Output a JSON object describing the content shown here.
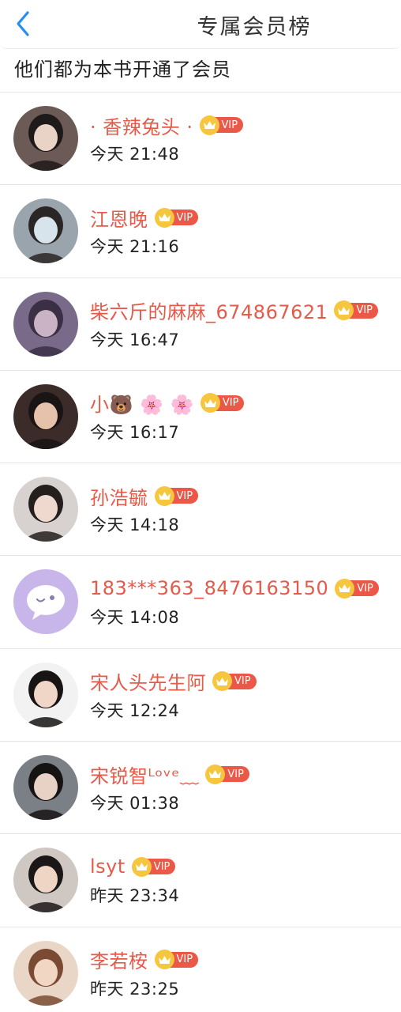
{
  "header": {
    "title": "专属会员榜",
    "back_icon": "chevron-left-icon",
    "accent": "#2a8cf0"
  },
  "subtitle": "他们都为本书开通了会员",
  "badge": {
    "label": "VIP",
    "crown_icon": "crown-icon",
    "tag_color": "#eb5848",
    "crown_color": "#f7c63f"
  },
  "name_color": "#e65a4a",
  "members": [
    {
      "name": "· 香辣兔头 ·",
      "time": "今天 21:48",
      "avatar": {
        "bg": "#6b5a55",
        "fg": "#e9d2c6",
        "hair": "#1e1a1a"
      }
    },
    {
      "name": "江恩晚",
      "time": "今天 21:16",
      "avatar": {
        "bg": "#9aa4ad",
        "fg": "#d8e4ec",
        "hair": "#2a2625"
      }
    },
    {
      "name": "柴六斤的麻麻_674867621",
      "time": "今天 16:47",
      "avatar": {
        "bg": "#7a6a8a",
        "fg": "#c9b3c4",
        "hair": "#3a2f45"
      }
    },
    {
      "name": "小🐻 🌸 🌸",
      "time": "今天 16:17",
      "avatar": {
        "bg": "#3b2c2a",
        "fg": "#e6c2aa",
        "hair": "#1a1414"
      }
    },
    {
      "name": "孙浩毓",
      "time": "今天 14:18",
      "avatar": {
        "bg": "#d7d2cf",
        "fg": "#efd9cf",
        "hair": "#241e1d"
      }
    },
    {
      "name": "183***363_8476163150",
      "time": "今天 14:08",
      "avatar": {
        "bg": "#c8b6ea",
        "fg": "#ffffff",
        "hair": "#8b7bb0"
      }
    },
    {
      "name": "宋人头先生阿",
      "time": "今天 12:24",
      "avatar": {
        "bg": "#f2f2f2",
        "fg": "#f0d6c6",
        "hair": "#181414"
      }
    },
    {
      "name": "宋锐智ᴸᵒᵛᵉ﹏",
      "time": "今天 01:38",
      "avatar": {
        "bg": "#7b7f86",
        "fg": "#e8d2c6",
        "hair": "#161313"
      }
    },
    {
      "name": "lsyt",
      "time": "昨天 23:34",
      "avatar": {
        "bg": "#cfc8c2",
        "fg": "#efd5c4",
        "hair": "#1c1717"
      }
    },
    {
      "name": "李若桉",
      "time": "昨天 23:25",
      "avatar": {
        "bg": "#e9d6c6",
        "fg": "#f1d6c3",
        "hair": "#7a4b32"
      }
    }
  ]
}
